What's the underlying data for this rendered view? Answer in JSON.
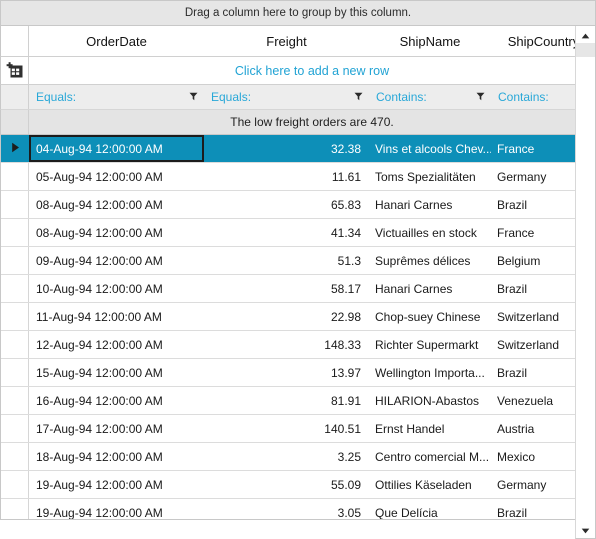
{
  "grid": {
    "group_panel_text": "Drag a column here to group by this column.",
    "new_row_text": "Click here to add a new row",
    "summary_text": "The low freight orders are 470.",
    "accent_color": "#0d8fb8",
    "link_color": "#29a8d8",
    "add_row_icon": "add-grid-icon",
    "row_indicator_icon": "play-triangle-icon",
    "filter_icon": "funnel-icon",
    "scroll_up_icon": "triangle-up-icon",
    "scroll_down_icon": "triangle-down-icon",
    "columns": [
      {
        "key": "OrderDate",
        "label": "OrderDate",
        "filter_label": "Equals:"
      },
      {
        "key": "Freight",
        "label": "Freight",
        "filter_label": "Equals:"
      },
      {
        "key": "ShipName",
        "label": "ShipName",
        "filter_label": "Contains:"
      },
      {
        "key": "ShipCountry",
        "label": "ShipCountry",
        "filter_label": "Contains:"
      }
    ],
    "rows": [
      {
        "OrderDate": "04-Aug-94 12:00:00 AM",
        "Freight": "32.38",
        "ShipName": "Vins et alcools Chev...",
        "ShipCountry": "France",
        "selected": true,
        "focused": true
      },
      {
        "OrderDate": "05-Aug-94 12:00:00 AM",
        "Freight": "11.61",
        "ShipName": "Toms Spezialitäten",
        "ShipCountry": "Germany",
        "selected": false,
        "focused": false
      },
      {
        "OrderDate": "08-Aug-94 12:00:00 AM",
        "Freight": "65.83",
        "ShipName": "Hanari Carnes",
        "ShipCountry": "Brazil",
        "selected": false,
        "focused": false
      },
      {
        "OrderDate": "08-Aug-94 12:00:00 AM",
        "Freight": "41.34",
        "ShipName": "Victuailles en stock",
        "ShipCountry": "France",
        "selected": false,
        "focused": false
      },
      {
        "OrderDate": "09-Aug-94 12:00:00 AM",
        "Freight": "51.3",
        "ShipName": "Suprêmes délices",
        "ShipCountry": "Belgium",
        "selected": false,
        "focused": false
      },
      {
        "OrderDate": "10-Aug-94 12:00:00 AM",
        "Freight": "58.17",
        "ShipName": "Hanari Carnes",
        "ShipCountry": "Brazil",
        "selected": false,
        "focused": false
      },
      {
        "OrderDate": "11-Aug-94 12:00:00 AM",
        "Freight": "22.98",
        "ShipName": "Chop-suey Chinese",
        "ShipCountry": "Switzerland",
        "selected": false,
        "focused": false
      },
      {
        "OrderDate": "12-Aug-94 12:00:00 AM",
        "Freight": "148.33",
        "ShipName": "Richter Supermarkt",
        "ShipCountry": "Switzerland",
        "selected": false,
        "focused": false
      },
      {
        "OrderDate": "15-Aug-94 12:00:00 AM",
        "Freight": "13.97",
        "ShipName": "Wellington Importa...",
        "ShipCountry": "Brazil",
        "selected": false,
        "focused": false
      },
      {
        "OrderDate": "16-Aug-94 12:00:00 AM",
        "Freight": "81.91",
        "ShipName": "HILARION-Abastos",
        "ShipCountry": "Venezuela",
        "selected": false,
        "focused": false
      },
      {
        "OrderDate": "17-Aug-94 12:00:00 AM",
        "Freight": "140.51",
        "ShipName": "Ernst Handel",
        "ShipCountry": "Austria",
        "selected": false,
        "focused": false
      },
      {
        "OrderDate": "18-Aug-94 12:00:00 AM",
        "Freight": "3.25",
        "ShipName": "Centro comercial M...",
        "ShipCountry": "Mexico",
        "selected": false,
        "focused": false
      },
      {
        "OrderDate": "19-Aug-94 12:00:00 AM",
        "Freight": "55.09",
        "ShipName": "Ottilies Käseladen",
        "ShipCountry": "Germany",
        "selected": false,
        "focused": false
      },
      {
        "OrderDate": "19-Aug-94 12:00:00 AM",
        "Freight": "3.05",
        "ShipName": "Que Delícia",
        "ShipCountry": "Brazil",
        "selected": false,
        "focused": false
      }
    ]
  }
}
